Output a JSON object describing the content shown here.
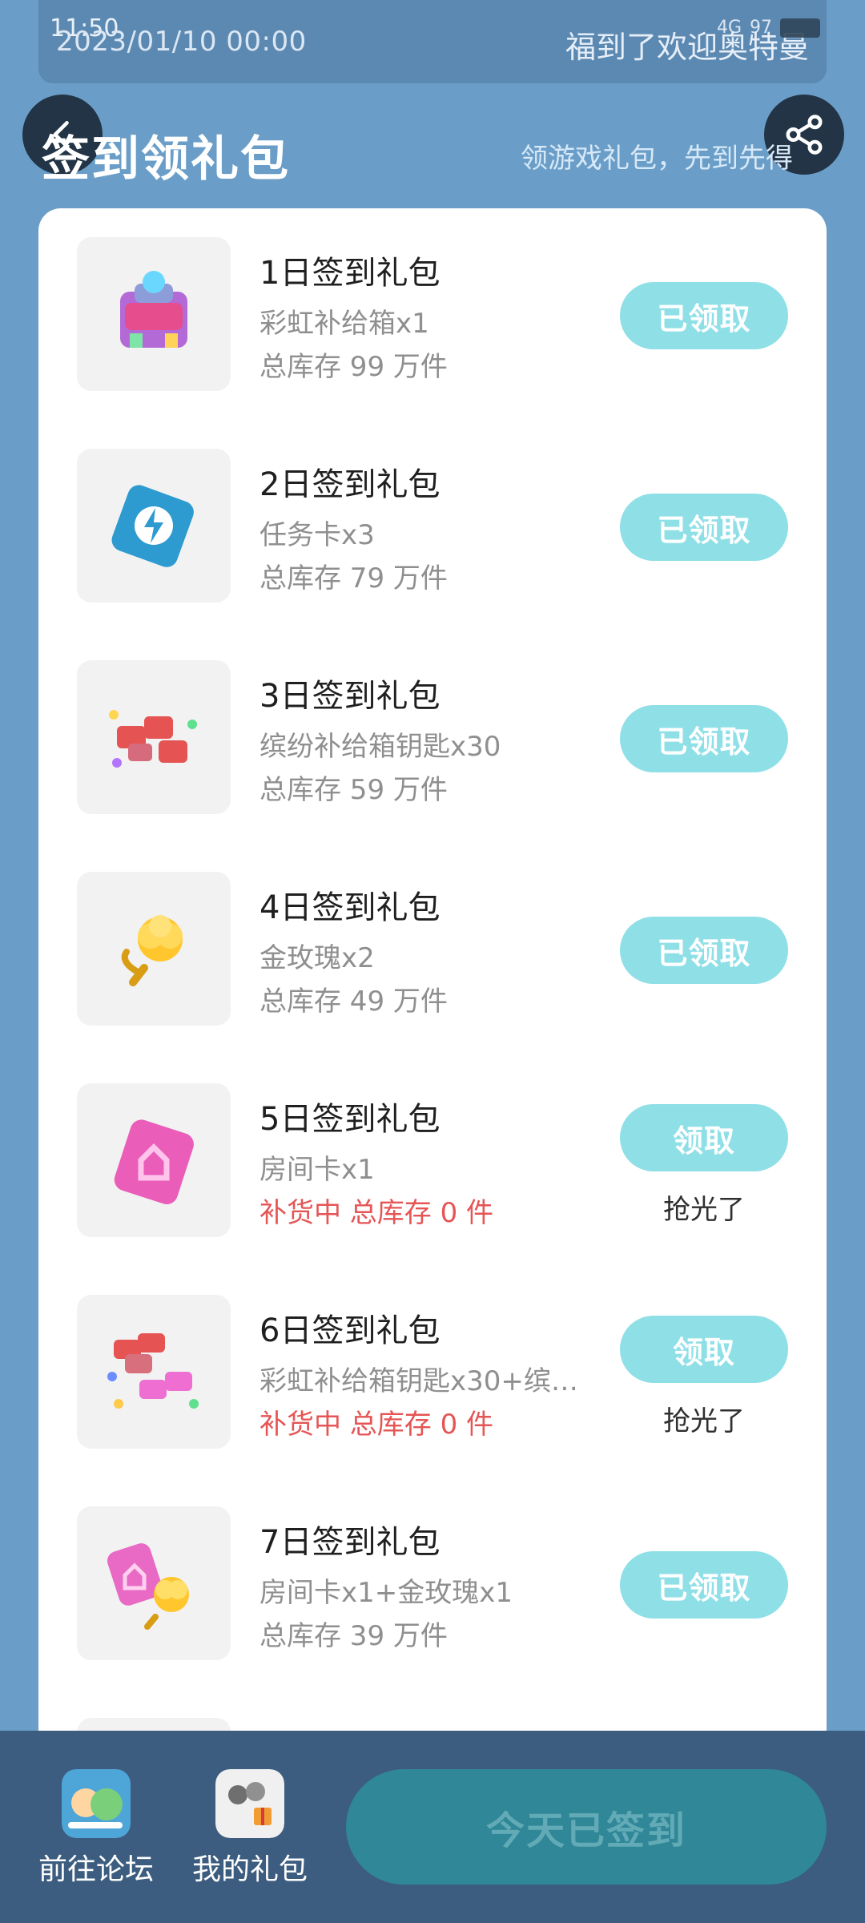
{
  "status_bar": {
    "time": "11:50",
    "network": "4G",
    "battery": "97"
  },
  "header_card": {
    "date": "2023/01/10 00:00",
    "right_text": "福到了欢迎奥特曼"
  },
  "page": {
    "title": "签到领礼包",
    "subtitle": "领游戏礼包，先到先得"
  },
  "gifts": [
    {
      "title": "1日签到礼包",
      "content": "彩虹补给箱x1",
      "stock": "总库存 99 万件",
      "button": "已领取",
      "sold_out": ""
    },
    {
      "title": "2日签到礼包",
      "content": "任务卡x3",
      "stock": "总库存 79 万件",
      "button": "已领取",
      "sold_out": ""
    },
    {
      "title": "3日签到礼包",
      "content": "缤纷补给箱钥匙x30",
      "stock": "总库存 59 万件",
      "button": "已领取",
      "sold_out": ""
    },
    {
      "title": "4日签到礼包",
      "content": "金玫瑰x2",
      "stock": "总库存 49 万件",
      "button": "已领取",
      "sold_out": ""
    },
    {
      "title": "5日签到礼包",
      "content": "房间卡x1",
      "stock": "补货中 总库存 0 件",
      "button": "领取",
      "sold_out": "抢光了"
    },
    {
      "title": "6日签到礼包",
      "content": "彩虹补给箱钥匙x30+缤…",
      "stock": "补货中 总库存 0 件",
      "button": "领取",
      "sold_out": "抢光了"
    },
    {
      "title": "7日签到礼包",
      "content": "房间卡x1+金玫瑰x1",
      "stock": "总库存 39 万件",
      "button": "已领取",
      "sold_out": ""
    }
  ],
  "bottom_bar": {
    "forum_label": "前往论坛",
    "my_gifts_label": "我的礼包",
    "checkin_button": "今天已签到"
  },
  "colors": {
    "background": "#6a9ec8",
    "button": "#8fdfe7",
    "checkin_button": "#2f8797",
    "warning": "#e55555"
  }
}
